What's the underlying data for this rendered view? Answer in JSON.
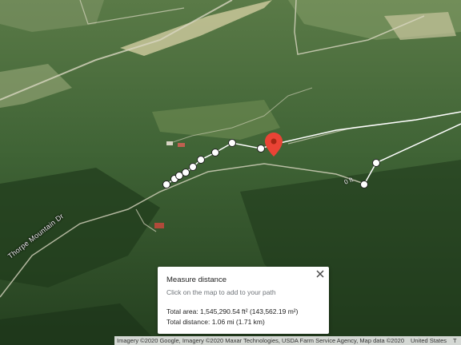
{
  "map": {
    "view": "satellite-3d",
    "road_label": "Thorpe Mountain Dr",
    "segment_label": "0 ft",
    "pin_color": "#ea4335"
  },
  "measure_card": {
    "title": "Measure distance",
    "hint": "Click on the map to add to your path",
    "total_area": "Total area: 1,545,290.54 ft² (143,562.19 m²)",
    "total_distance": "Total distance: 1.06 mi (1.71 km)",
    "close_icon": "close-icon"
  },
  "attribution": {
    "imagery": "Imagery ©2020 Google, Imagery ©2020 Maxar Technologies, USDA Farm Service Agency, Map data ©2020",
    "region": "United States",
    "terms": "T"
  }
}
